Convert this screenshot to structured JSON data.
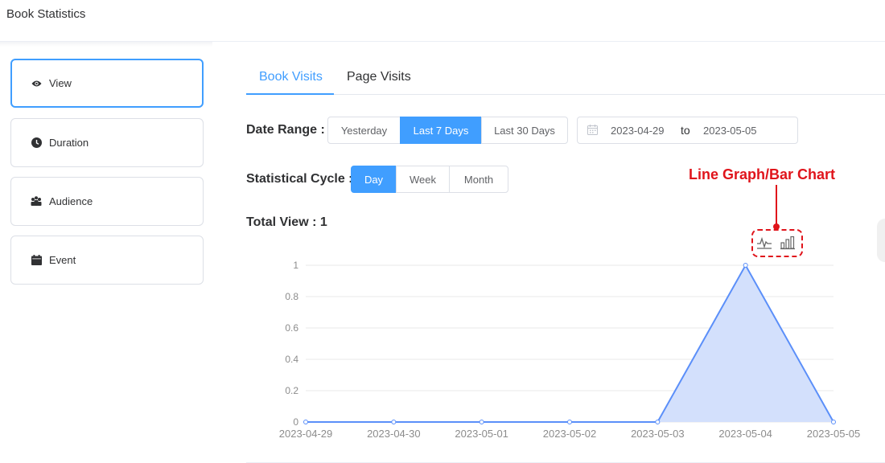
{
  "header": {
    "title": "Book Statistics"
  },
  "sidebar": {
    "items": [
      {
        "label": "View",
        "icon": "eye-icon",
        "active": true
      },
      {
        "label": "Duration",
        "icon": "clock-icon",
        "active": false
      },
      {
        "label": "Audience",
        "icon": "users-icon",
        "active": false
      },
      {
        "label": "Event",
        "icon": "calendar-icon",
        "active": false
      }
    ]
  },
  "tabs": [
    {
      "label": "Book Visits",
      "active": true
    },
    {
      "label": "Page Visits",
      "active": false
    }
  ],
  "date_range": {
    "label": "Date Range :",
    "options": [
      "Yesterday",
      "Last 7 Days",
      "Last 30 Days"
    ],
    "selected": "Last 7 Days",
    "start": "2023-04-29",
    "separator": "to",
    "end": "2023-05-05"
  },
  "cycle": {
    "label": "Statistical Cycle :",
    "options": [
      "Day",
      "Week",
      "Month"
    ],
    "selected": "Day"
  },
  "total": {
    "label": "Total View : 1"
  },
  "annotation": {
    "text": "Line Graph/Bar Chart"
  },
  "chart_toggle": {
    "line_icon": "line-graph-icon",
    "bar_icon": "bar-chart-icon"
  },
  "colors": {
    "accent": "#409eff",
    "series": "#5b8ff9",
    "fill": "#d3e0fc",
    "annotation": "#e0141b"
  },
  "chart_data": {
    "type": "area",
    "x": [
      "2023-04-29",
      "2023-04-30",
      "2023-05-01",
      "2023-05-02",
      "2023-05-03",
      "2023-05-04",
      "2023-05-05"
    ],
    "values": [
      0,
      0,
      0,
      0,
      0,
      1,
      0
    ],
    "ylim": [
      0,
      1
    ],
    "yticks": [
      "0",
      "0.2",
      "0.4",
      "0.6",
      "0.8",
      "1"
    ],
    "grid": true
  }
}
